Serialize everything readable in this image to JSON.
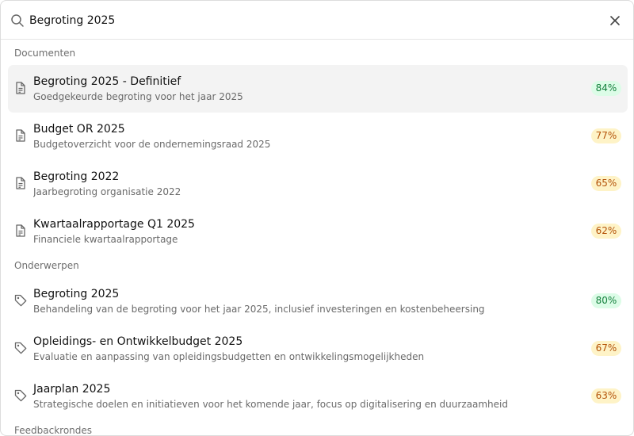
{
  "search": {
    "value": "Begroting 2025",
    "icon": "search-icon",
    "close_icon": "close-icon"
  },
  "groups": [
    {
      "heading": "Documenten",
      "icon": "document-icon",
      "items": [
        {
          "title": "Begroting 2025 - Definitief",
          "description": "Goedgekeurde begroting voor het jaar 2025",
          "score": "84%",
          "score_color": "#15803d",
          "selected": true
        },
        {
          "title": "Budget OR 2025",
          "description": "Budgetoverzicht voor de ondernemingsraad 2025",
          "score": "77%",
          "score_color": "#b45309",
          "selected": false
        },
        {
          "title": "Begroting 2022",
          "description": "Jaarbegroting organisatie 2022",
          "score": "65%",
          "score_color": "#b45309",
          "selected": false
        },
        {
          "title": "Kwartaalrapportage Q1 2025",
          "description": "Financiele kwartaalrapportage",
          "score": "62%",
          "score_color": "#b45309",
          "selected": false
        }
      ]
    },
    {
      "heading": "Onderwerpen",
      "icon": "tag-icon",
      "items": [
        {
          "title": "Begroting 2025",
          "description": "Behandeling van de begroting voor het jaar 2025, inclusief investeringen en kostenbeheersing",
          "score": "80%",
          "score_color": "#15803d",
          "selected": false
        },
        {
          "title": "Opleidings- en Ontwikkelbudget 2025",
          "description": "Evaluatie en aanpassing van opleidingsbudgetten en ontwikkelingsmogelijkheden",
          "score": "67%",
          "score_color": "#b45309",
          "selected": false
        },
        {
          "title": "Jaarplan 2025",
          "description": "Strategische doelen en initiatieven voor het komende jaar, focus op digitalisering en duurzaamheid",
          "score": "63%",
          "score_color": "#b45309",
          "selected": false
        }
      ]
    },
    {
      "heading": "Feedbackrondes",
      "icon": "",
      "items": []
    }
  ]
}
